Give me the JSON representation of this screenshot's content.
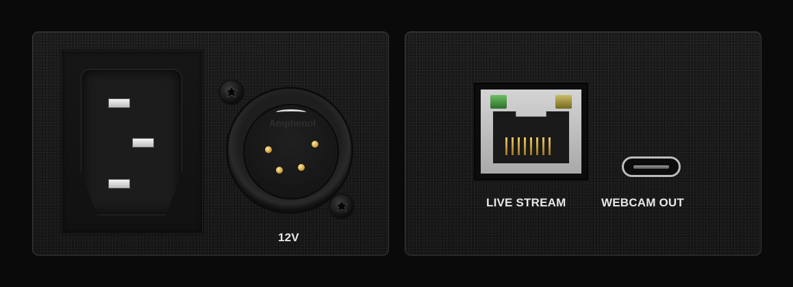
{
  "left_panel": {
    "power_inlet_icon": "iec-c14-inlet-icon",
    "xlr_brand": "Amphenol",
    "dc_label": "12V"
  },
  "right_panel": {
    "ethernet_label": "LIVE STREAM",
    "usb_label": "WEBCAM OUT"
  },
  "colors": {
    "background": "#0a0a0a",
    "panel": "#1e1e1e",
    "label_text": "#e8e8e8",
    "led_green": "#4a9a43",
    "led_yellow": "#a5993f",
    "gold_pins": "#d4a23a"
  }
}
